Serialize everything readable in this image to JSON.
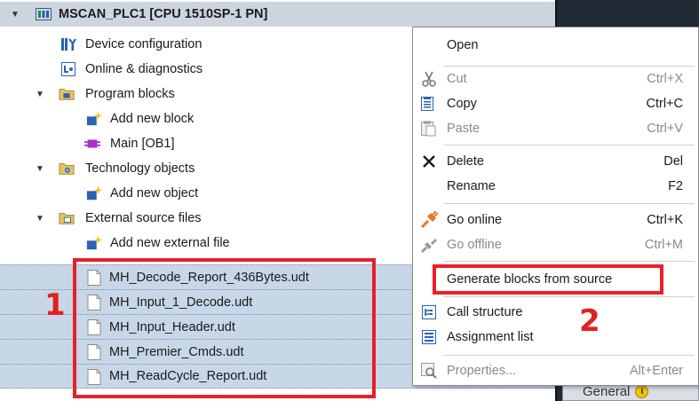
{
  "tree": {
    "root": "MSCAN_PLC1 [CPU 1510SP-1 PN]",
    "items": [
      {
        "label": "Device configuration"
      },
      {
        "label": "Online & diagnostics"
      },
      {
        "label": "Program blocks"
      },
      {
        "label": "Add new block"
      },
      {
        "label": "Main [OB1]"
      },
      {
        "label": "Technology objects"
      },
      {
        "label": "Add new object"
      },
      {
        "label": "External source files"
      },
      {
        "label": "Add new external file"
      }
    ],
    "selected_files": [
      {
        "label": "MH_Decode_Report_436Bytes.udt"
      },
      {
        "label": "MH_Input_1_Decode.udt"
      },
      {
        "label": "MH_Input_Header.udt"
      },
      {
        "label": "MH_Premier_Cmds.udt"
      },
      {
        "label": "MH_ReadCycle_Report.udt"
      }
    ]
  },
  "context_menu": {
    "items": [
      {
        "label": "Open",
        "shortcut": "",
        "enabled": true
      },
      {
        "label": "Cut",
        "shortcut": "Ctrl+X",
        "enabled": false
      },
      {
        "label": "Copy",
        "shortcut": "Ctrl+C",
        "enabled": true
      },
      {
        "label": "Paste",
        "shortcut": "Ctrl+V",
        "enabled": false
      },
      {
        "label": "Delete",
        "shortcut": "Del",
        "enabled": true
      },
      {
        "label": "Rename",
        "shortcut": "F2",
        "enabled": true
      },
      {
        "label": "Go online",
        "shortcut": "Ctrl+K",
        "enabled": true
      },
      {
        "label": "Go offline",
        "shortcut": "Ctrl+M",
        "enabled": false
      },
      {
        "label": "Generate blocks from source",
        "shortcut": "",
        "enabled": true
      },
      {
        "label": "Call structure",
        "shortcut": "",
        "enabled": true
      },
      {
        "label": "Assignment list",
        "shortcut": "",
        "enabled": true
      },
      {
        "label": "Properties...",
        "shortcut": "Alt+Enter",
        "enabled": false
      }
    ]
  },
  "inspector_tab": {
    "label": "General"
  },
  "annotations": {
    "step1": "1",
    "step2": "2",
    "color": "#e8202a"
  }
}
